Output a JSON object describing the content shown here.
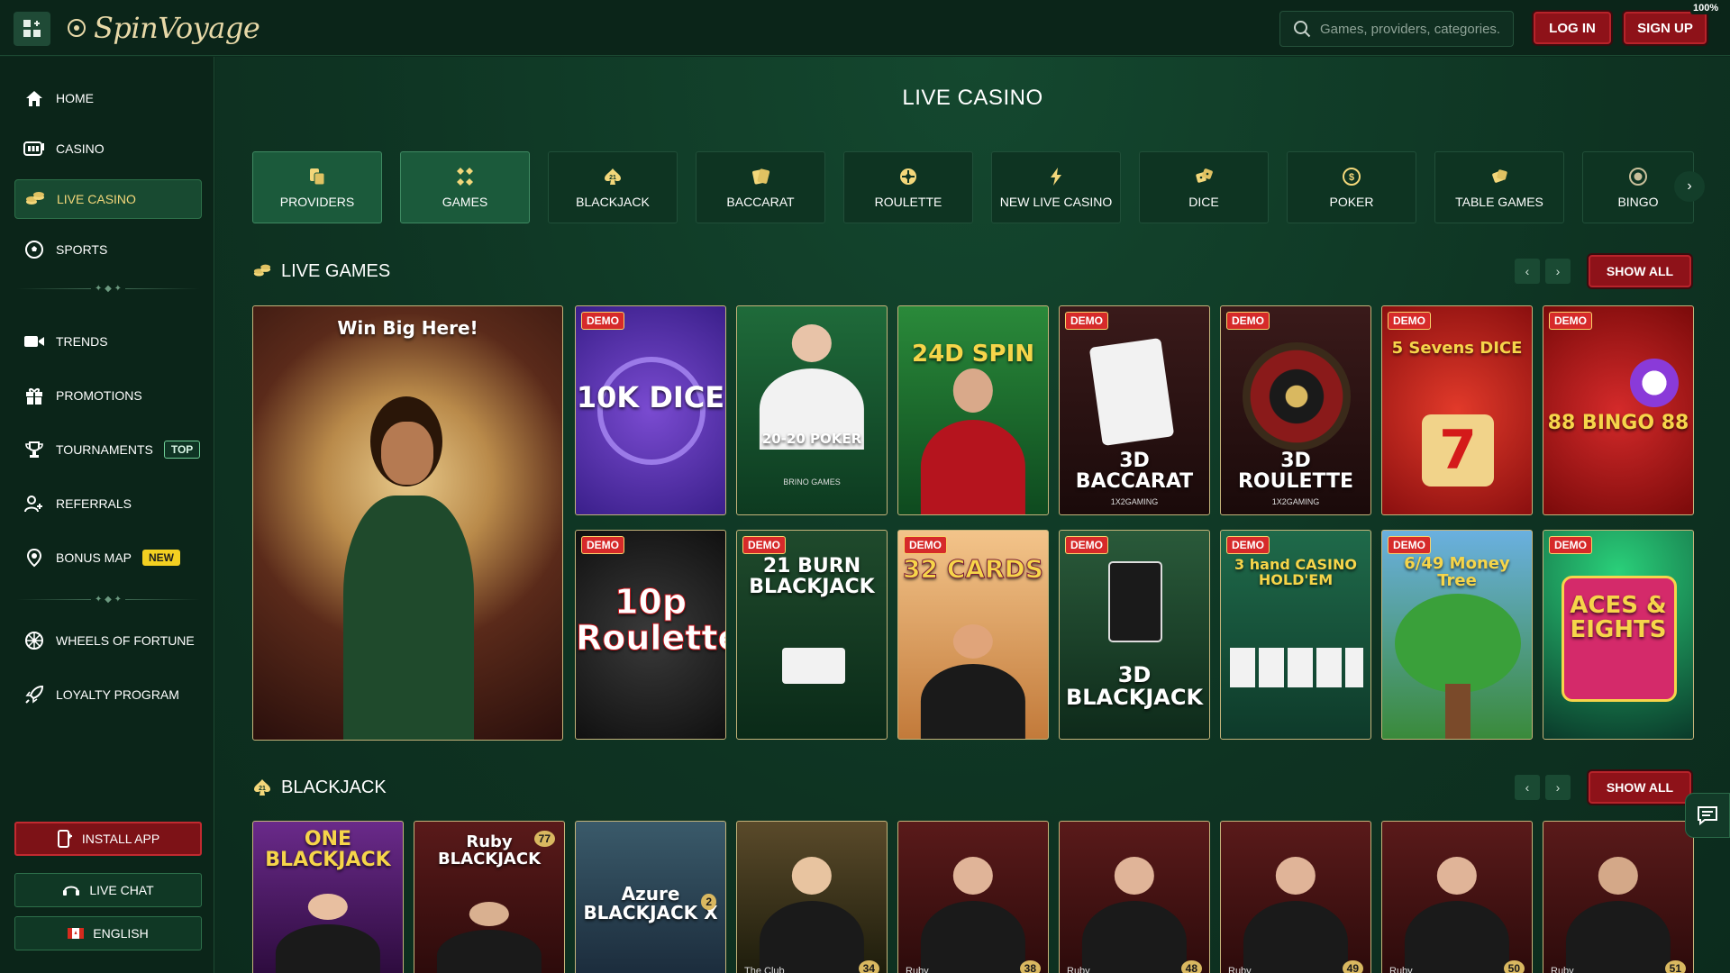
{
  "header": {
    "brand": "SpinVoyage",
    "search_placeholder": "Games, providers, categories...",
    "login_label": "LOG IN",
    "signup_label": "SIGN UP",
    "battery": "100%"
  },
  "sidebar": {
    "items": [
      {
        "label": "HOME",
        "icon": "home-icon"
      },
      {
        "label": "CASINO",
        "icon": "slot-icon"
      },
      {
        "label": "LIVE CASINO",
        "icon": "chips-icon",
        "active": true
      },
      {
        "label": "SPORTS",
        "icon": "soccer-ball-icon"
      },
      {
        "label": "TRENDS",
        "icon": "video-icon"
      },
      {
        "label": "PROMOTIONS",
        "icon": "gift-icon"
      },
      {
        "label": "TOURNAMENTS",
        "icon": "trophy-icon",
        "badge": "TOP"
      },
      {
        "label": "REFERRALS",
        "icon": "users-icon"
      },
      {
        "label": "BONUS MAP",
        "icon": "map-pin-icon",
        "badge": "NEW"
      },
      {
        "label": "WHEELS OF FORTUNE",
        "icon": "wheel-icon"
      },
      {
        "label": "LOYALTY PROGRAM",
        "icon": "rocket-icon"
      }
    ],
    "install_label": "INSTALL APP",
    "livechat_label": "LIVE CHAT",
    "language_label": "ENGLISH"
  },
  "main": {
    "title": "LIVE CASINO",
    "categories": [
      {
        "label": "PROVIDERS",
        "selected": true
      },
      {
        "label": "GAMES",
        "selected": true
      },
      {
        "label": "BLACKJACK"
      },
      {
        "label": "BACCARAT"
      },
      {
        "label": "ROULETTE"
      },
      {
        "label": "NEW LIVE CASINO"
      },
      {
        "label": "DICE"
      },
      {
        "label": "POKER"
      },
      {
        "label": "TABLE GAMES"
      },
      {
        "label": "BINGO"
      }
    ],
    "live_games": {
      "heading": "LIVE GAMES",
      "show_all": "SHOW ALL",
      "feature_banner": "Win Big Here!",
      "demo_label": "DEMO",
      "games": [
        {
          "title": "10K DICE",
          "demo": true
        },
        {
          "title": "20-20 POKER",
          "sub": "BRINO GAMES",
          "demo": false
        },
        {
          "title": "24D SPIN",
          "demo": false
        },
        {
          "title": "3D BACCARAT",
          "sub": "1X2GAMING",
          "demo": true
        },
        {
          "title": "3D ROULETTE",
          "sub": "1X2GAMING",
          "demo": true
        },
        {
          "title": "5 Sevens DICE",
          "demo": true
        },
        {
          "title": "88 BINGO 88",
          "demo": true
        },
        {
          "title": "10p Roulette",
          "demo": true
        },
        {
          "title": "21 BURN BLACKJACK",
          "demo": true
        },
        {
          "title": "32 CARDS",
          "demo": true
        },
        {
          "title": "3D BLACKJACK",
          "demo": true
        },
        {
          "title": "3 hand CASINO HOLD'EM",
          "demo": true
        },
        {
          "title": "6/49 Money Tree",
          "demo": true
        },
        {
          "title": "ACES & EIGHTS",
          "demo": true
        }
      ]
    },
    "blackjack": {
      "heading": "BLACKJACK",
      "show_all": "SHOW ALL",
      "games": [
        {
          "title": "ONE BLACKJACK"
        },
        {
          "title": "Ruby BLACKJACK",
          "badge": "77"
        },
        {
          "title": "Azure BLACKJACK X",
          "badge": "2"
        },
        {
          "title": "The Club",
          "badge": "34"
        },
        {
          "title": "Ruby",
          "badge": "38"
        },
        {
          "title": "Ruby",
          "badge": "48"
        },
        {
          "title": "Ruby",
          "badge": "49"
        },
        {
          "title": "Ruby",
          "badge": "50"
        },
        {
          "title": "Ruby",
          "badge": "51"
        }
      ]
    }
  },
  "colors": {
    "background": "#0c2a1c",
    "accent_gold": "#f3d77a",
    "accent_red": "#8e1219",
    "badge_new": "#f3d021"
  }
}
